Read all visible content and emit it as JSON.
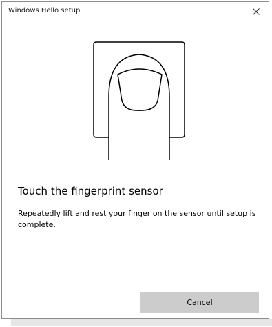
{
  "window": {
    "title": "Windows Hello setup"
  },
  "icons": {
    "close": "close-icon",
    "illustration": "fingerprint-sensor-icon"
  },
  "content": {
    "heading": "Touch the fingerprint sensor",
    "description": "Repeatedly lift and rest your finger on the sensor until setup is complete."
  },
  "actions": {
    "cancel_label": "Cancel"
  },
  "colors": {
    "button_bg": "#cccccc",
    "window_border": "#8c8c8c"
  }
}
